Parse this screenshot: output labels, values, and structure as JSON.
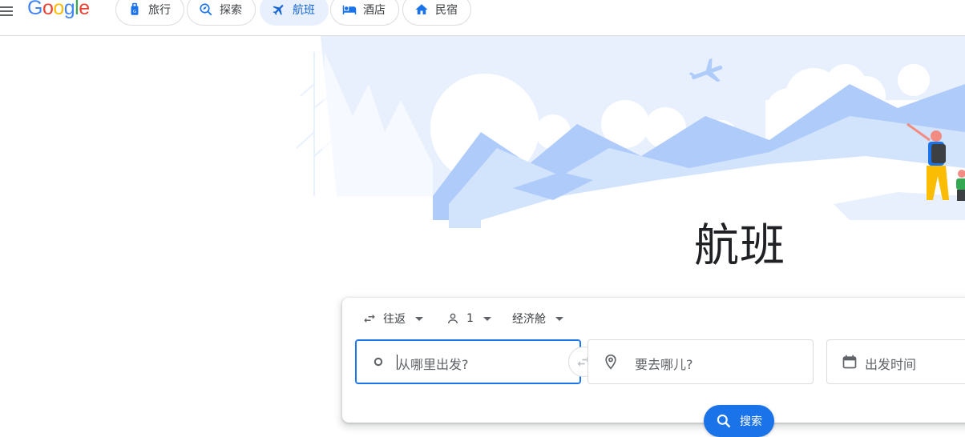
{
  "header": {
    "logo": "Google",
    "tabs": [
      {
        "label": "旅行",
        "icon": "luggage-icon"
      },
      {
        "label": "探索",
        "icon": "explore-icon"
      },
      {
        "label": "航班",
        "icon": "flight-icon"
      },
      {
        "label": "酒店",
        "icon": "hotel-bed-icon"
      },
      {
        "label": "民宿",
        "icon": "home-icon"
      }
    ]
  },
  "hero": {
    "title": "航班"
  },
  "search": {
    "trip_type": "往返",
    "passengers": "1",
    "cabin_class": "经济舱",
    "origin_placeholder": "从哪里出发?",
    "destination_placeholder": "要去哪儿?",
    "departure_placeholder": "出发时间",
    "search_label": "搜索"
  },
  "colors": {
    "accent": "#1a73e8",
    "active_tab_bg": "#e8f0fe",
    "hero_sky": "#e8f0fe",
    "hero_mountain": "#aecbfa"
  }
}
